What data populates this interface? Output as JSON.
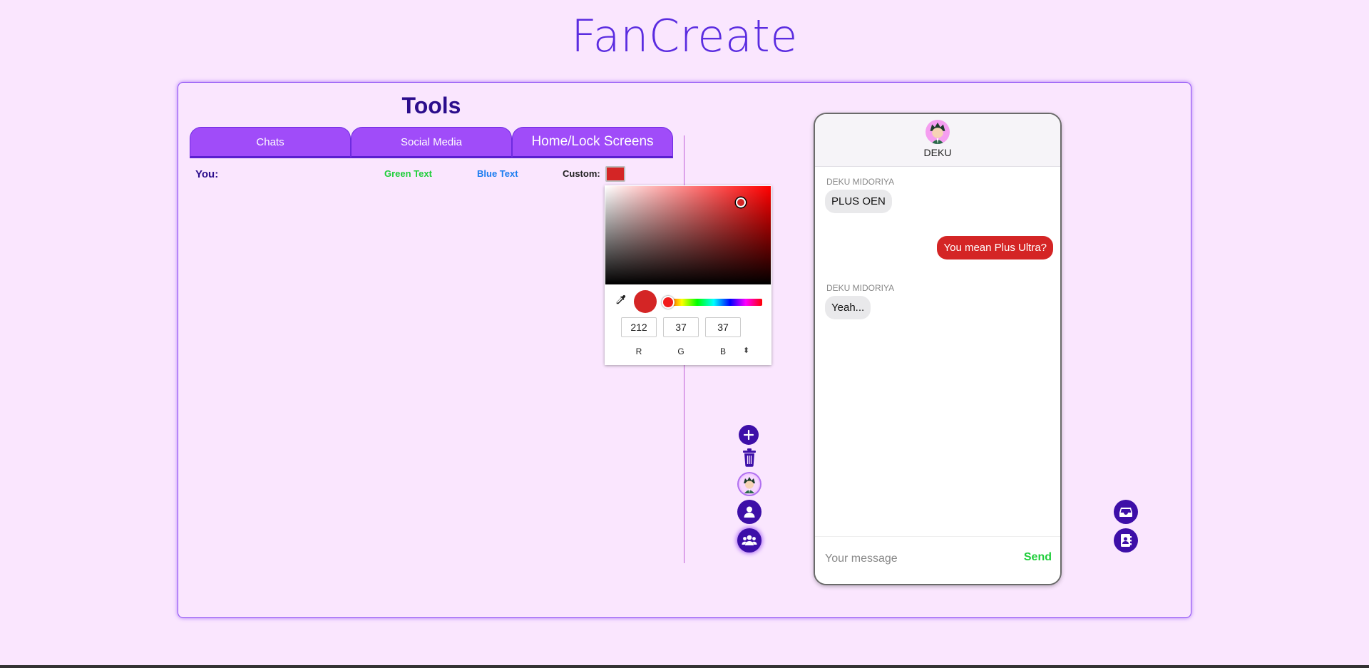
{
  "app": {
    "title": "FanCreate"
  },
  "tools": {
    "title": "Tools",
    "tabs": [
      {
        "label": "Chats"
      },
      {
        "label": "Social Media"
      },
      {
        "label": "Home/Lock Screens"
      }
    ],
    "you_label": "You:",
    "options": {
      "green": "Green Text",
      "blue": "Blue Text",
      "custom_label": "Custom:"
    },
    "custom_color": "#d42525"
  },
  "color_picker": {
    "r": "212",
    "g": "37",
    "b": "37",
    "labels": {
      "r": "R",
      "g": "G",
      "b": "B"
    },
    "toggle": "⬍"
  },
  "side_icons": [
    "add-icon",
    "trash-icon",
    "avatar-icon",
    "person-icon",
    "group-icon"
  ],
  "right_icons": [
    "inbox-icon",
    "contact-card-icon"
  ],
  "phone": {
    "contact_name": "DEKU",
    "messages": [
      {
        "sender": "DEKU MIDORIYA",
        "text": "PLUS OEN",
        "direction": "in"
      },
      {
        "text": "You mean Plus Ultra?",
        "direction": "out"
      },
      {
        "sender": "DEKU MIDORIYA",
        "text": "Yeah...",
        "direction": "in"
      }
    ],
    "input_placeholder": "Your message",
    "send_label": "Send"
  },
  "colors": {
    "accent": "#a04cf9",
    "dark": "#3d0fa8",
    "send": "#1fce3a",
    "bubble_out": "#d42525"
  }
}
